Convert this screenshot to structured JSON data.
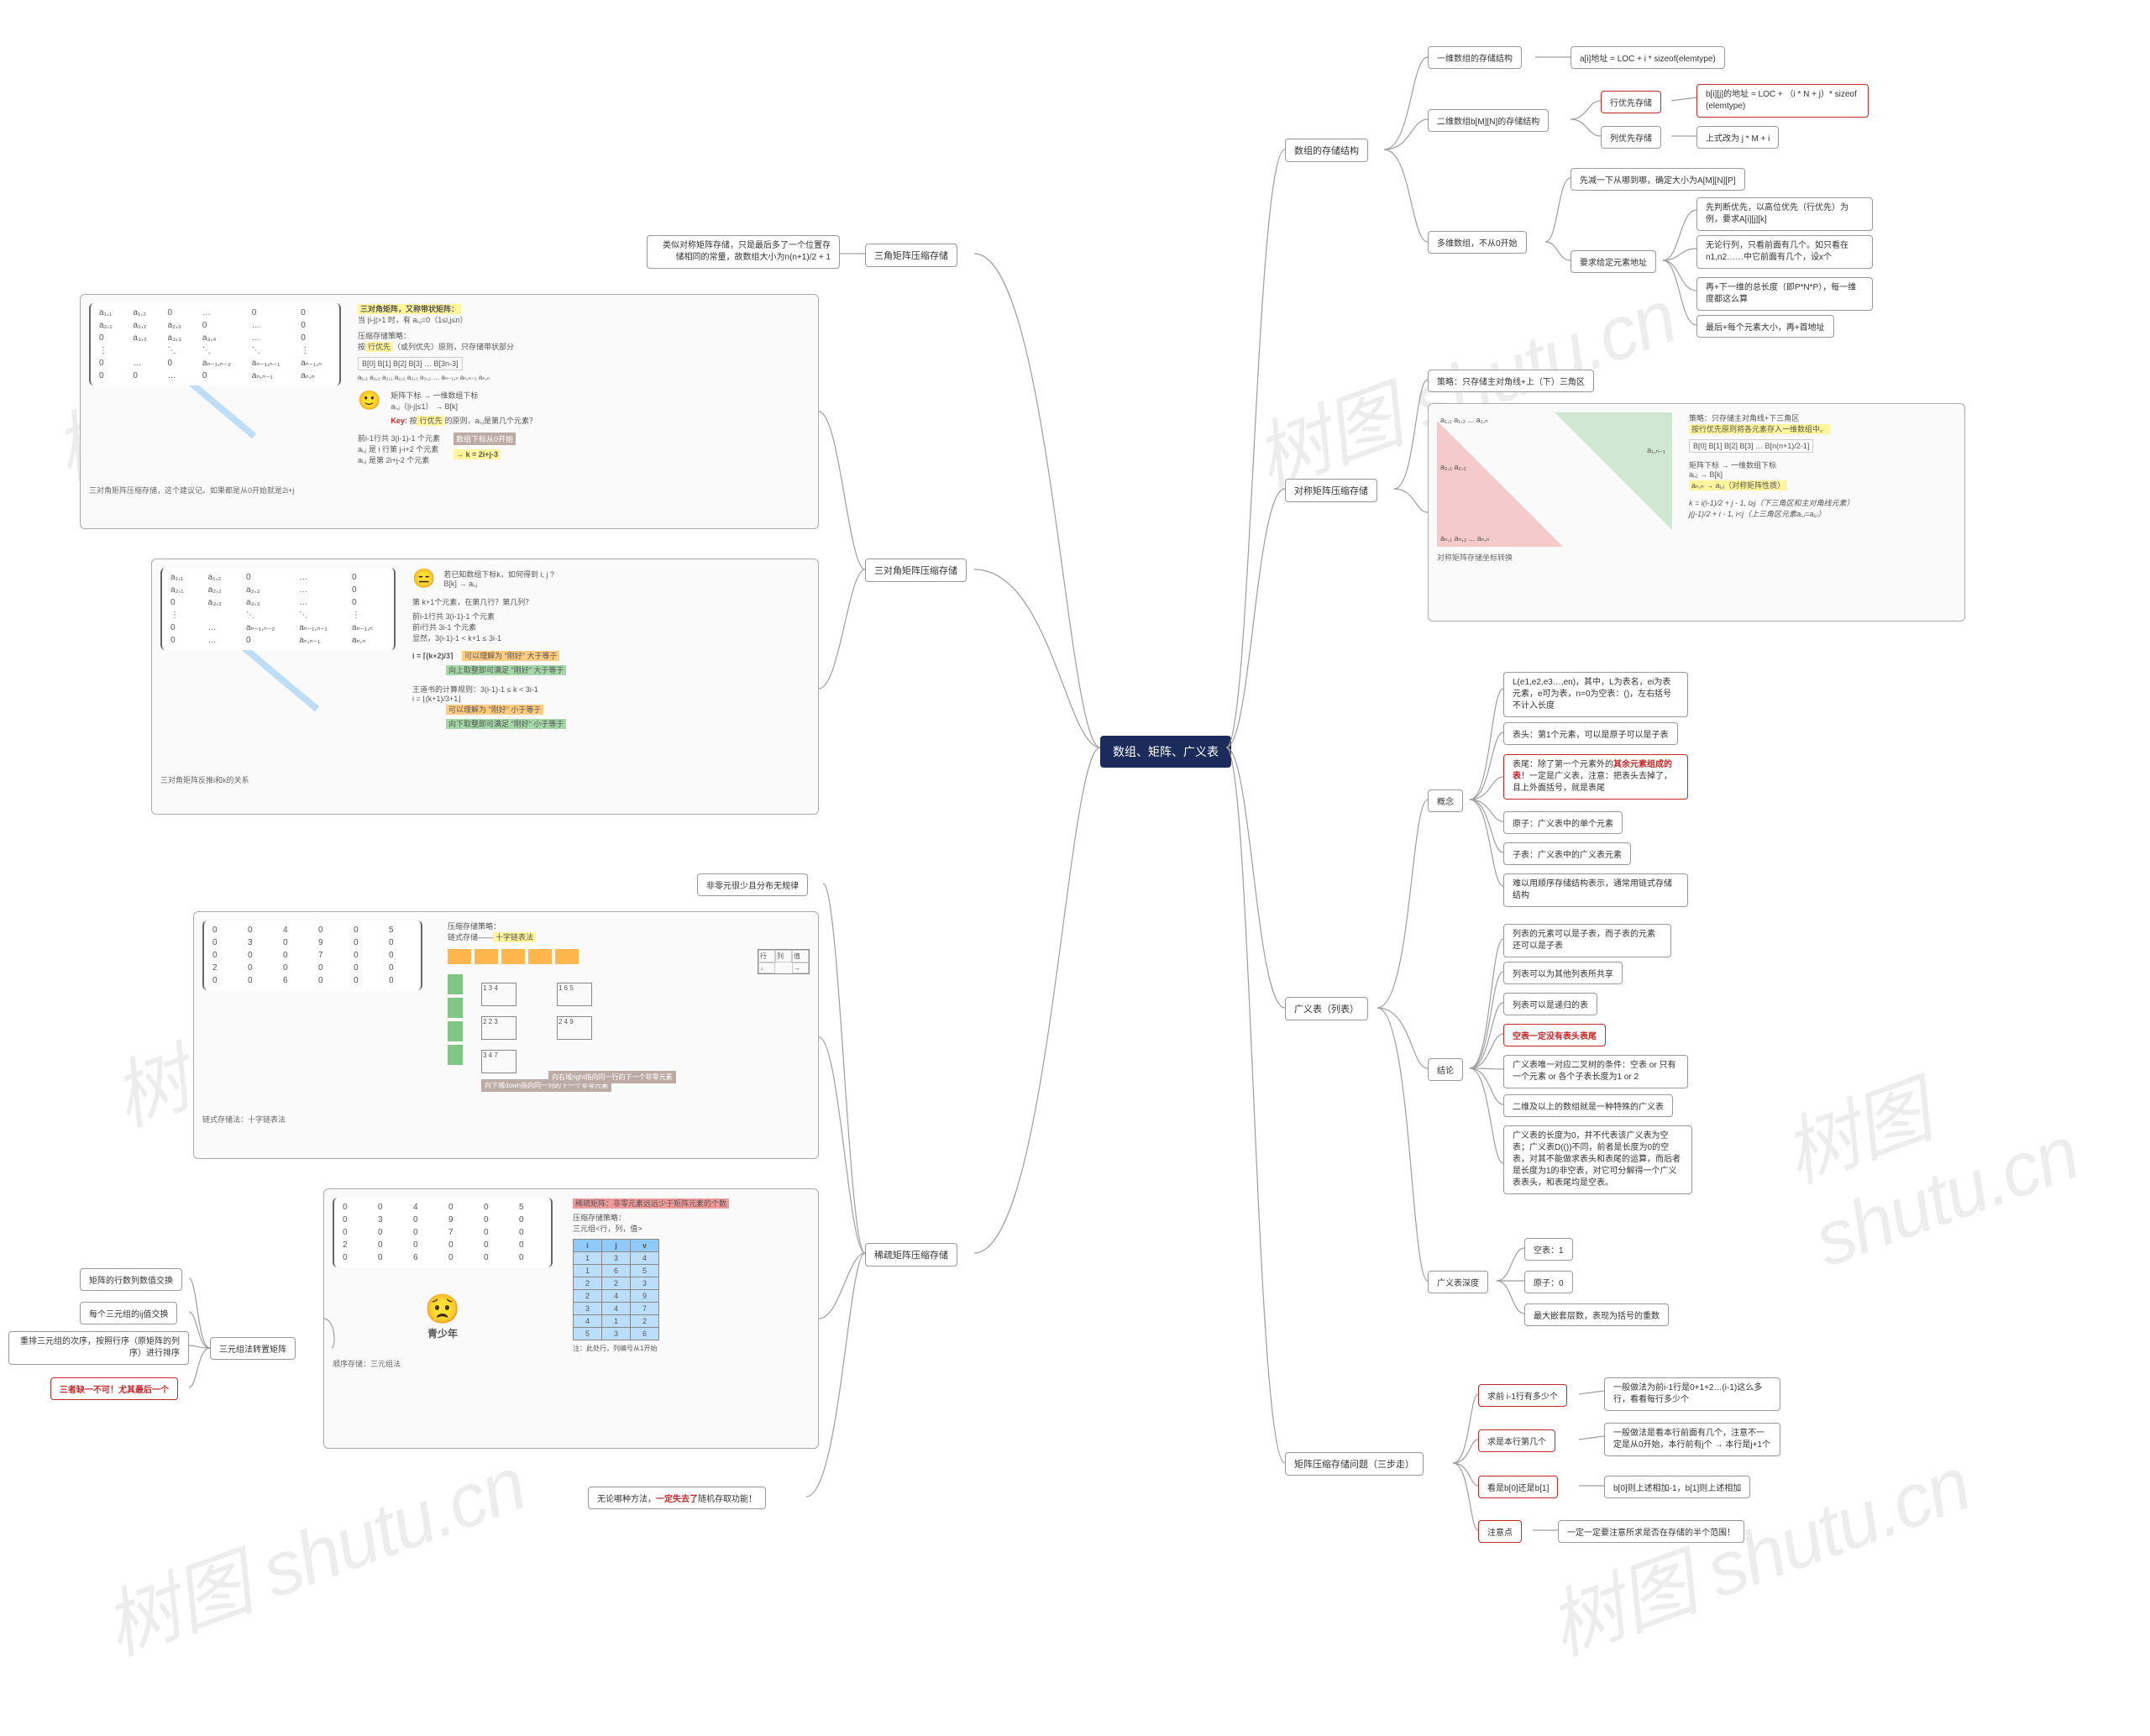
{
  "root": "数组、矩阵、广义表",
  "watermark": "树图 shutu.cn",
  "right": {
    "storage": {
      "label": "数组的存储结构",
      "oneD": "一维数组的存储结构",
      "oneD_formula": "a[i]地址 = LOC + i * sizeof(elemtype)",
      "twoD": "二维数组b[M][N]的存储结构",
      "rowMajor": "行优先存储",
      "rowMajor_formula": "b[i][j]的地址 = LOC + （i * N + j）* sizeof (elemtype)",
      "colMajor": "列优先存储",
      "colMajor_formula": "上式改为 j * M + i",
      "multi": "多维数组，不从0开始",
      "multi1": "先减一下从哪到哪，确定大小为A[M][N][P]",
      "multi2": "要求给定元素地址",
      "multi2a": "先判断优先，以高位优先（行优先）为例，要求A[i][j][k]",
      "multi2b": "无论行列，只看前面有几个。如只看在n1,n2……中它前面有几个，设x个",
      "multi2c": "再+下一维的总长度（即P*N*P），每一维度都这么算",
      "multi2d": "最后+每个元素大小，再+首地址"
    },
    "sym": {
      "label": "对称矩阵压缩存储",
      "policy": "策略：只存储主对角线+上（下）三角区",
      "caption": "对称矩阵存储坐标转换",
      "desc1": "策略：只存储主对角线+下三角区",
      "desc2": "按行优先原则将各元素存入一维数组中。",
      "row_b": "B[0]  B[1]  B[2]  B[3]  …  B[n(n+1)/2-1]",
      "map1": "矩阵下标 → 一维数组下标",
      "map2": "aᵢ,ⱼ  →  B[k]",
      "map3": "aₙ,ₙ → aⱼ,ᵢ（对称矩阵性质）",
      "form": "k = i(i-1)/2 + j - 1,   i≥j（下三角区和主对角线元素）\n    j(j-1)/2 + i - 1,   i<j（上三角区元素aᵢ,ⱼ=aⱼ,ᵢ）"
    },
    "glist": {
      "label": "广义表（列表）",
      "concept": "概念",
      "c1": "L(e1,e2,e3…,en)，其中，L为表名，ei为表元素，e可为表，n=0为空表：()，左右括号不计入长度",
      "c2": "表头：第1个元素，可以是原子可以是子表",
      "c3": "表尾：除了第一个元素外的其余元素组成的表！一定是广义表，注意：把表头去掉了，且上外面括号，就是表尾",
      "c4": "原子：广义表中的单个元素",
      "c5": "子表：广义表中的广义表元素",
      "c6": "难以用顺序存储结构表示，通常用链式存储结构",
      "concl": "结论",
      "l1": "列表的元素可以是子表，而子表的元素还可以是子表",
      "l2": "列表可以为其他列表所共享",
      "l3": "列表可以是递归的表",
      "l4": "空表一定没有表头表尾",
      "l5": "广义表唯一对应二叉树的条件：空表 or 只有一个元素 or 各个子表长度为1 or 2",
      "l6": "二维及以上的数组就是一种特殊的广义表",
      "l7": "广义表的长度为0，并不代表该广义表为空表；广义表D(())不同，前者是长度为0的空表，对其不能做求表头和表尾的运算，而后者是长度为1的非空表，对它可分解得一个广义表表头，和表尾均是空表。",
      "depth": "广义表深度",
      "d1": "空表：1",
      "d2": "原子：0",
      "d3": "最大嵌套层数，表现为括号的重数"
    },
    "compress": {
      "label": "矩阵压缩存储问题（三步走）",
      "s1": "求前 i-1行有多少个",
      "s1a": "一般做法为前i-1行是0+1+2…(i-1)这么多行，看看每行多少个",
      "s2": "求是本行第几个",
      "s2a": "一般做法是看本行前面有几个，注意不一定是从0开始，本行前有j个 → 本行是j+1个",
      "s3": "看是b[0]还是b[1]",
      "s3a": "b[0]则上述相加-1，b[1]则上述相加",
      "s4": "注意点",
      "s4a": "一定一定要注意所求是否在存储的半个范围！"
    }
  },
  "left": {
    "tri": {
      "label": "三角矩阵压缩存储",
      "desc": "类似对称矩阵存储，只是最后多了一个位置存储相同的常量，故数组大小为n(n+1)/2 + 1"
    },
    "tridiag": {
      "label": "三对角矩阵压缩存储",
      "caption1": "三对角矩阵压缩存储，这个建议记。如果都是从0开始就是2i+j",
      "caption2": "三对角矩阵反推i和k的关系",
      "t1_title": "三对角矩阵，又称带状矩阵：",
      "t1_cond": "当 |i-j|>1 时，有 aᵢ,ⱼ=0（1≤i,j≤n）",
      "t1_strategy": "压缩存储策略：\n按行优先（或列优先）原则，只存储带状部分",
      "t1_row": "B[0] B[1] B[2] B[3]  …  B[3n-3]",
      "t1_map": "矩阵下标  →  一维数组下标\naᵢ,ⱼ（|i-j|≤1） →  B[k]",
      "t1_key": "Key: 按行优先的原则，aᵢ,ⱼ是第几个元素？",
      "t1_steps": "前i-1行共 3(i-1)-1 个元素\naᵢ,ⱼ 是 i 行第 j-i+2 个元素\naᵢ,ⱼ 是第 2i+j-2 个元素",
      "t1_tag": "数组下标从0开始",
      "t1_res": "→ k = 2i+j-3",
      "t2_q": "若已知数组下标k，如何得到 i, j ?",
      "t2_a": "→ aᵢ,ⱼ",
      "t2_l1": "第 k+1个元素，在第几行？第几列？",
      "t2_l2": "前i-1行共 3(i-1)-1 个元素\n前i行共 3i-1 个元素\n显然，3(i-1)-1 < k+1 ≤ 3i-1",
      "t2_l3": "i = ⌈(k+2)/3⌉",
      "t2_l3a": "可以理解为 \"刚好\" 大于等于",
      "t2_l3b": "向上取整即可满足 \"刚好\" 大于等于",
      "t2_l4": "王道书的计算规则：3(i-1)-1 ≤ k < 3i-1\ni = ⌊(k+1)/3+1⌋",
      "t2_l4a": "可以理解为 \"刚好\" 小于等于",
      "t2_l4b": "向下取整即可满足 \"刚好\" 小于等于"
    },
    "sparse": {
      "label": "稀疏矩阵压缩存储",
      "cond": "非零元很少且分布无规律",
      "caption1": "链式存储法：十字链表法",
      "caption2": "顺序存储：三元组法",
      "cl_title": "压缩存储策略：\n链式存储——十字链表法",
      "seq_title": "稀疏矩阵：非零元素远远少于矩阵元素的个数",
      "seq_strategy": "压缩存储策略：\n三元组<行，列，值>",
      "seq_note": "注：此处行，列编号从1开始",
      "table_h": [
        "i",
        "j",
        "v"
      ],
      "table": [
        [
          1,
          3,
          4
        ],
        [
          1,
          6,
          5
        ],
        [
          2,
          2,
          3
        ],
        [
          2,
          4,
          9
        ],
        [
          3,
          4,
          7
        ],
        [
          4,
          1,
          2
        ],
        [
          5,
          3,
          6
        ]
      ],
      "matrix": [
        [
          0,
          0,
          4,
          0,
          0,
          5
        ],
        [
          0,
          3,
          0,
          9,
          0,
          0
        ],
        [
          0,
          0,
          0,
          7,
          0,
          0
        ],
        [
          2,
          0,
          0,
          0,
          0,
          0
        ],
        [
          0,
          0,
          6,
          0,
          0,
          0
        ]
      ],
      "trans": "三元组法转置矩阵",
      "tr1": "矩阵的行数列数值交换",
      "tr2": "每个三元组的ij值交换",
      "tr3": "重排三元组的次序，按照行序（原矩阵的列序）进行排序",
      "tr4": "三者缺一不可！尤其最后一个",
      "lose": "无论哪种方法，一定失去了随机存取功能！"
    }
  }
}
